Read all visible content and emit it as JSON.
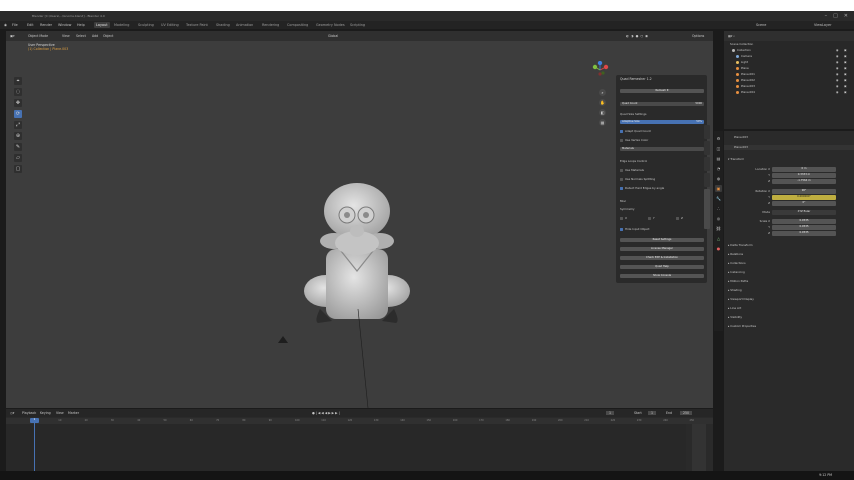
{
  "window": {
    "title": "Blender [C:\\Users\\...\\Gnome.blend] - Blender 4.0",
    "controls": [
      "–",
      "□",
      "✕"
    ]
  },
  "top_menu": {
    "items": [
      "File",
      "Edit",
      "Render",
      "Window",
      "Help"
    ],
    "workspaces": [
      "Layout",
      "Modeling",
      "Sculpting",
      "UV Editing",
      "Texture Paint",
      "Shading",
      "Animation",
      "Rendering",
      "Compositing",
      "Geometry Nodes",
      "Scripting"
    ],
    "active_workspace": "Layout",
    "scene_label": "Scene",
    "view_layer_label": "ViewLayer"
  },
  "viewport": {
    "header_items": [
      "Object Mode",
      "View",
      "Select",
      "Add",
      "Object",
      "Global",
      "Options"
    ],
    "info_line1": "User Perspective",
    "info_line2": "(1) Collection | Plane.003",
    "tool_icons": [
      "cursor-icon",
      "select-box-icon",
      "move-icon",
      "rotate-icon",
      "scale-icon",
      "transform-icon",
      "annotate-icon",
      "measure-icon",
      "add-cube-icon"
    ]
  },
  "quad_remesh": {
    "title": "Quad Remesher 1.2",
    "remesh_button": "Remesh It",
    "quad_count_label": "Quad Count",
    "quad_count_value": "5000",
    "quad_size_label": "Quad Size Settings",
    "adaptive_size_label": "Adaptive Size",
    "adaptive_size_value": "50%",
    "adapt_quad_count": "Adapt Quad Count",
    "use_vertex_color": "Use Vertex Color",
    "materials_label": "Materials",
    "use_normals_label": "Use Normals Splitting",
    "detect_edges": "Detect Hard Edges by angle",
    "edge_loops_label": "Edge Loops Control",
    "use_materials": "Use Materials",
    "misc_label": "Misc",
    "symmetry_label": "Symmetry",
    "sym_axes": [
      "X",
      "Y",
      "Z"
    ],
    "hide_input": "Hide Input Object",
    "buttons": [
      "Reset Settings",
      "License Manager",
      "Check EXE & Installation",
      "Quad Help",
      "Show Console"
    ],
    "side_tabs": [
      "Item",
      "Tool",
      "View",
      "Edit",
      "Quad Remesh"
    ]
  },
  "timeline": {
    "header_items": [
      "Playback",
      "Keying",
      "View",
      "Marker"
    ],
    "current_frame": "1",
    "start_label": "Start",
    "start_value": "1",
    "end_label": "End",
    "end_value": "250",
    "ruler_numbers": [
      "0",
      "10",
      "20",
      "30",
      "40",
      "50",
      "60",
      "70",
      "80",
      "90",
      "100",
      "110",
      "120",
      "130",
      "140",
      "150",
      "160",
      "170",
      "180",
      "190",
      "200",
      "210",
      "220",
      "230",
      "240",
      "250"
    ]
  },
  "outliner": {
    "title": "Scene Collection",
    "rows": [
      "Collection",
      "Camera",
      "Light",
      "Plane",
      "Plane.001",
      "Plane.002",
      "Plane.003",
      "Plane.004"
    ],
    "row_colors": [
      "#b8b8b8",
      "#7fa8d8",
      "#e8c060",
      "#e89040",
      "#e89040",
      "#e89040",
      "#e89040",
      "#e89040"
    ]
  },
  "properties": {
    "object_name": "Plane.003",
    "transform_label": "Transform",
    "location_label": "Location X",
    "loc_values": [
      "0 m",
      "0.3333 m",
      "-1.7564 m"
    ],
    "rotation_label": "Rotation X",
    "rot_values": [
      "90°",
      "0.000000°",
      "0°"
    ],
    "mode_label": "Mode",
    "mode_value": "XYZ Euler",
    "scale_label": "Scale X",
    "scale_values": [
      "0.0535",
      "0.0535",
      "0.0535"
    ],
    "sections": [
      "Delta Transform",
      "Relations",
      "Collections",
      "Instancing",
      "Motion Paths",
      "Shading",
      "Viewport Display",
      "Line Art",
      "Visibility",
      "Custom Properties"
    ],
    "xyz": [
      "X",
      "Y",
      "Z"
    ]
  },
  "taskbar": {
    "clock": "9:12 PM"
  }
}
